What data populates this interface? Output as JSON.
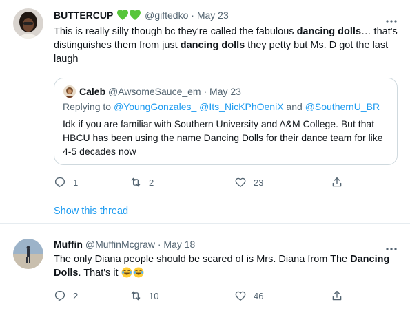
{
  "tweet1": {
    "author_name": "BUTTERCUP",
    "handle": "@giftedko",
    "separator": "·",
    "date": "May 23",
    "text_1": "This is really silly though bc they're called the fabulous ",
    "bold_1": "dancing dolls",
    "text_2": "… that's distinguishes them from just ",
    "bold_2": "dancing dolls",
    "text_3": " they petty but Ms. D got the last laugh",
    "quote": {
      "author_name": "Caleb",
      "handle": "@AwsomeSauce_em",
      "separator": "·",
      "date": "May 23",
      "replying_prefix": "Replying to ",
      "mention_1": "@YoungGonzales_",
      "mention_2": "@Its_NicKPhOeniX",
      "and_word": " and ",
      "mention_3": "@SouthernU_BR",
      "text": "Idk if you are familiar with Southern University and A&M College. But that HBCU has been using the name Dancing Dolls for their dance team for like 4-5 decades now"
    },
    "reply_count": "1",
    "retweet_count": "2",
    "like_count": "23",
    "show_thread_label": "Show this thread"
  },
  "tweet2": {
    "author_name": "Muffin",
    "handle": "@MuffinMcgraw",
    "separator": "·",
    "date": "May 18",
    "text_1": "The only Diana people should be scared of is Mrs. Diana from The ",
    "bold_1": "Dancing Dolls",
    "text_2": ". That's it ",
    "reply_count": "2",
    "retweet_count": "10",
    "like_count": "46"
  },
  "colors": {
    "text": "#0f1419",
    "secondary": "#536471",
    "link": "#1d9bf0",
    "heart_green": "#57c63a",
    "border": "#cfd9de"
  },
  "icons": [
    "green-heart-icon",
    "more-icon",
    "reply-icon",
    "retweet-icon",
    "like-icon",
    "share-icon",
    "laughing-emoji-icon"
  ]
}
